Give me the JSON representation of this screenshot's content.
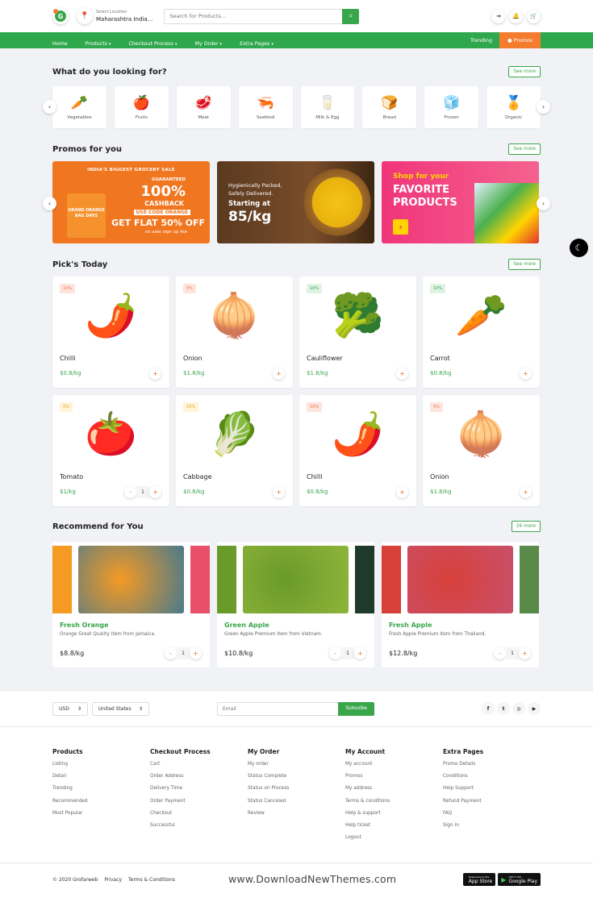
{
  "header": {
    "logo_letter": "G",
    "location_label": "Select Location",
    "location_value": "Maharashtra India...",
    "search_placeholder": "Search for Products...",
    "icons": [
      "sign-in-icon",
      "bell-icon",
      "cart-icon"
    ]
  },
  "nav": {
    "items": [
      {
        "label": "Home",
        "dropdown": false
      },
      {
        "label": "Products",
        "dropdown": true
      },
      {
        "label": "Checkout Process",
        "dropdown": true
      },
      {
        "label": "My Order",
        "dropdown": true
      },
      {
        "label": "Extra Pages",
        "dropdown": true
      }
    ],
    "trending": "Trending",
    "promos": "Promos"
  },
  "categories": {
    "title": "What do you looking for?",
    "see_more": "See more",
    "items": [
      {
        "label": "Vegetables",
        "icon": "🥕"
      },
      {
        "label": "Fruits",
        "icon": "🍎"
      },
      {
        "label": "Meat",
        "icon": "🥩"
      },
      {
        "label": "Seafood",
        "icon": "🦐"
      },
      {
        "label": "Milk & Egg",
        "icon": "🥛"
      },
      {
        "label": "Bread",
        "icon": "🍞"
      },
      {
        "label": "Frozen",
        "icon": "🧊"
      },
      {
        "label": "Organic",
        "icon": "🏅"
      }
    ]
  },
  "promos": {
    "title": "Promos for you",
    "see_more": "See more",
    "banner1": {
      "headline": "INDIA'S BIGGEST GROCERY SALE",
      "guaranteed": "GUARANTEED",
      "percent": "100%",
      "cashback": "CASHBACK",
      "code": "USE CODE ORANGE",
      "offer": "GET FLAT 50% OFF",
      "sub": "on sale sign up fee",
      "bag": "GRAND ORANGE BAG DAYS"
    },
    "banner2": {
      "line1": "Hygienically Packed,",
      "line2": "Safely Delivered.",
      "starting": "Starting at",
      "price": "85/kg"
    },
    "banner3": {
      "line1": "Shop for your",
      "line2": "FAVORITE",
      "line3": "PRODUCTS",
      "cta": "›"
    }
  },
  "picks": {
    "title": "Pick's Today",
    "see_more": "See more",
    "items": [
      {
        "name": "Chilli",
        "price": "$0.8/kg",
        "discount": "10%",
        "badge": "red",
        "icon": "🌶️"
      },
      {
        "name": "Onion",
        "price": "$1.8/kg",
        "discount": "5%",
        "badge": "red",
        "icon": "🧅"
      },
      {
        "name": "Cauliflower",
        "price": "$1.8/kg",
        "discount": "10%",
        "badge": "green",
        "icon": "🥦"
      },
      {
        "name": "Carrot",
        "price": "$0.8/kg",
        "discount": "10%",
        "badge": "green",
        "icon": "🥕"
      },
      {
        "name": "Tomato",
        "price": "$1/kg",
        "discount": "5%",
        "badge": "yellow",
        "icon": "🍅",
        "qty": "1"
      },
      {
        "name": "Cabbage",
        "price": "$0.8/kg",
        "discount": "15%",
        "badge": "yellow",
        "icon": "🥬"
      },
      {
        "name": "Chilli",
        "price": "$0.8/kg",
        "discount": "10%",
        "badge": "red",
        "icon": "🌶️"
      },
      {
        "name": "Onion",
        "price": "$1.8/kg",
        "discount": "5%",
        "badge": "red",
        "icon": "🧅"
      }
    ]
  },
  "recommend": {
    "title": "Recommend for You",
    "more": "26 more",
    "items": [
      {
        "name": "Fresh Orange",
        "desc": "Orange Great Quality item from Jamaica.",
        "price": "$8.8/kg",
        "qty": "1",
        "colors": [
          "#f59a23",
          "#4a7a8c",
          "#e8506a"
        ]
      },
      {
        "name": "Green Apple",
        "desc": "Green Apple Premium item from Vietnam.",
        "price": "$10.8/kg",
        "qty": "1",
        "colors": [
          "#6a9a2a",
          "#8fb53a",
          "#1e3a2a"
        ]
      },
      {
        "name": "Fresh Apple",
        "desc": "Fresh Apple Premium item from Thailand.",
        "price": "$12.8/kg",
        "qty": "1",
        "colors": [
          "#d8403a",
          "#c8506a",
          "#5a8a4a"
        ]
      }
    ]
  },
  "footer": {
    "currency": "USD",
    "country": "United States",
    "email_placeholder": "Email",
    "subscribe": "Subscribe",
    "social": [
      "f",
      "t",
      "ig",
      "yt"
    ],
    "columns": [
      {
        "title": "Products",
        "links": [
          "Listing",
          "Detail",
          "Trending",
          "Recommended",
          "Most Popular"
        ]
      },
      {
        "title": "Checkout Process",
        "links": [
          "Cart",
          "Order Address",
          "Delivery Time",
          "Order Payment",
          "Checkout",
          "Successful"
        ]
      },
      {
        "title": "My Order",
        "links": [
          "My order",
          "Status Complete",
          "Status on Process",
          "Status Canceled",
          "Review"
        ]
      },
      {
        "title": "My Account",
        "links": [
          "My account",
          "Promos",
          "My address",
          "Terms & conditions",
          "Help & support",
          "Help ticket",
          "Logout"
        ]
      },
      {
        "title": "Extra Pages",
        "links": [
          "Promo Details",
          "Conditions",
          "Help Support",
          "Refund Payment",
          "FAQ",
          "Sign In"
        ]
      }
    ],
    "copyright": "© 2020 Grofarweb",
    "privacy": "Privacy",
    "terms": "Terms & Conditions",
    "watermark": "www.DownloadNewThemes.com",
    "appstore_small": "Download on the",
    "appstore": "App Store",
    "googleplay_small": "GET IT ON",
    "googleplay": "Google Play"
  },
  "colors": {
    "primary": "#2fa84d",
    "accent": "#f57c2f",
    "background": "#f1f2f6"
  }
}
